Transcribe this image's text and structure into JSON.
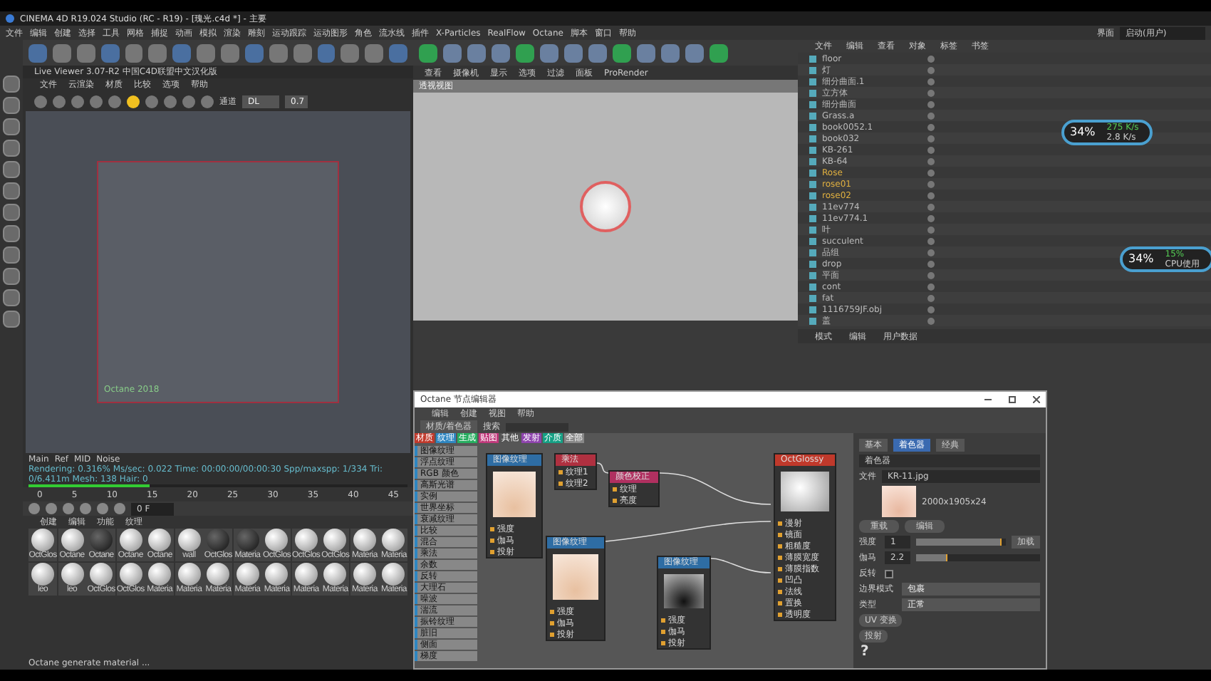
{
  "window": {
    "title": "CINEMA 4D R19.024 Studio (RC - R19) - [瑰光.c4d *] - 主要"
  },
  "menu": [
    "文件",
    "编辑",
    "创建",
    "选择",
    "工具",
    "网格",
    "捕捉",
    "动画",
    "模拟",
    "渲染",
    "雕刻",
    "运动跟踪",
    "运动图形",
    "角色",
    "流水线",
    "插件",
    "X-Particles",
    "RealFlow",
    "Octane",
    "脚本",
    "窗口",
    "帮助"
  ],
  "layout": {
    "label": "界面",
    "value": "启动(用户)"
  },
  "live_viewer": {
    "title": "Live Viewer 3.07-R2 中国C4D联盟中文汉化版",
    "menu": [
      "文件",
      "云渲染",
      "材质",
      "比较",
      "选项",
      "帮助"
    ],
    "mode_label": "通道",
    "mode_value": "DL",
    "value": "0.7",
    "overlay_text": "Octane 2018",
    "tabs": [
      "Main",
      "Ref",
      "MID",
      "Noise"
    ],
    "status": "Rendering: 0.316%  Ms/sec: 0.022  Time: 00:00:00/00:00:30  Spp/maxspp: 1/334  Tri: 0/6.411m  Mesh: 138  Hair: 0",
    "progress": {
      "level": 0.32
    },
    "ticks": [
      "0",
      "5",
      "10",
      "15",
      "20",
      "25",
      "30",
      "35",
      "40",
      "45"
    ],
    "frame": "0 F"
  },
  "materials": {
    "menu": [
      "创建",
      "编辑",
      "功能",
      "纹理"
    ],
    "items": [
      {
        "label": "OctGlos"
      },
      {
        "label": "Octane"
      },
      {
        "label": "Octane"
      },
      {
        "label": "Octane"
      },
      {
        "label": "Octane"
      },
      {
        "label": "wall"
      },
      {
        "label": "OctGlos"
      },
      {
        "label": "Materia"
      },
      {
        "label": "OctGlos"
      },
      {
        "label": "OctGlos"
      },
      {
        "label": "OctGlos"
      },
      {
        "label": "Materia"
      },
      {
        "label": "Materia"
      },
      {
        "label": "leo"
      },
      {
        "label": "leo"
      },
      {
        "label": "OctGlos"
      },
      {
        "label": "OctGlos"
      },
      {
        "label": "Materia"
      },
      {
        "label": "Materia"
      },
      {
        "label": "Materia"
      },
      {
        "label": "Materia"
      },
      {
        "label": "Materia"
      },
      {
        "label": "Materia"
      },
      {
        "label": "Materia"
      },
      {
        "label": "Materia"
      },
      {
        "label": "Materia"
      }
    ],
    "status": "Octane generate material ..."
  },
  "viewport": {
    "menu": [
      "查看",
      "摄像机",
      "显示",
      "选项",
      "过滤",
      "面板",
      "ProRender"
    ],
    "label": "透视视图"
  },
  "objects": {
    "tabs": [
      "文件",
      "编辑",
      "查看",
      "对象",
      "标签",
      "书签"
    ],
    "rows": [
      {
        "name": "floor",
        "highlight": false
      },
      {
        "name": "灯",
        "highlight": false
      },
      {
        "name": "细分曲面.1",
        "highlight": false
      },
      {
        "name": "立方体",
        "highlight": false
      },
      {
        "name": "细分曲面",
        "highlight": false
      },
      {
        "name": "Grass.a",
        "highlight": false
      },
      {
        "name": "book0052.1",
        "highlight": false
      },
      {
        "name": "book032",
        "highlight": false
      },
      {
        "name": "KB-261",
        "highlight": false
      },
      {
        "name": "KB-64",
        "highlight": false
      },
      {
        "name": "Rose",
        "highlight": true
      },
      {
        "name": "rose01",
        "highlight": true
      },
      {
        "name": "rose02",
        "highlight": true
      },
      {
        "name": "11ev774",
        "highlight": false
      },
      {
        "name": "11ev774.1",
        "highlight": false
      },
      {
        "name": "叶",
        "highlight": false
      },
      {
        "name": "succulent",
        "highlight": false
      },
      {
        "name": "品组",
        "highlight": false
      },
      {
        "name": "drop",
        "highlight": false
      },
      {
        "name": "平面",
        "highlight": false
      },
      {
        "name": "cont",
        "highlight": false
      },
      {
        "name": "fat",
        "highlight": false
      },
      {
        "name": "1116759JF.obj",
        "highlight": false
      },
      {
        "name": "盖",
        "highlight": false
      }
    ]
  },
  "monitor": [
    {
      "value": "34%",
      "line_1": "275 K/s",
      "line_2": "2.8 K/s"
    },
    {
      "value": "34%",
      "line_1": "15%",
      "line_2": "CPU使用"
    }
  ],
  "attributes": {
    "menu": [
      "模式",
      "编辑",
      "用户数据"
    ],
    "tabs": [
      {
        "label": "基本",
        "selected": false
      },
      {
        "label": "着色器",
        "selected": true
      },
      {
        "label": "经典",
        "selected": false
      }
    ],
    "section": "着色器",
    "file_label": "文件",
    "file": "KR-11.jpg",
    "image_info": "2000x1905x24",
    "buttons": [
      "重载",
      "编辑"
    ],
    "fields": [
      {
        "label": "强度",
        "value": "1",
        "level": 0.95,
        "button": "加载"
      },
      {
        "label": "伽马",
        "value": "2.2",
        "level": 0.25
      }
    ],
    "invert_label": "反转",
    "invert": false,
    "selects": [
      {
        "label": "边界模式",
        "value": "包裹"
      },
      {
        "label": "类型",
        "value": "正常"
      }
    ],
    "extra_buttons": [
      "UV 变换",
      "投射"
    ],
    "help": "?"
  },
  "node_editor": {
    "title": "Octane 节点编辑器",
    "menu": [
      "编辑",
      "创建",
      "视图",
      "帮助"
    ],
    "mode_button": "材质/着色器",
    "search": "搜索",
    "categories": [
      {
        "label": "材质",
        "color": "#c0392b"
      },
      {
        "label": "纹理",
        "color": "#2e86c1"
      },
      {
        "label": "生成",
        "color": "#27ae60"
      },
      {
        "label": "贴图",
        "color": "#c0397b"
      },
      {
        "label": "其他",
        "color": "#555555"
      },
      {
        "label": "发射",
        "color": "#8e44ad"
      },
      {
        "label": "介质",
        "color": "#16a085"
      },
      {
        "label": "全部",
        "color": "#888888"
      }
    ],
    "list": [
      "图像纹理",
      "浮点纹理",
      "RGB 颜色",
      "高斯光谱",
      "实例",
      "世界坐标",
      "衰减纹理",
      "比较",
      "混合",
      "乘法",
      "余数",
      "反转",
      "大理石",
      "噪波",
      "湍流",
      "振铃纹理",
      "脏旧",
      "侧面",
      "梯度"
    ],
    "nodes": [
      {
        "title": "图像纹理",
        "kind": "texture",
        "color": "#2e6da4",
        "ports": [
          "强度",
          "伽马",
          "投射"
        ]
      },
      {
        "title": "乘法",
        "kind": "op",
        "color": "#b03040",
        "ports": [
          "纹理1",
          "纹理2"
        ]
      },
      {
        "title": "颜色校正",
        "kind": "op",
        "color": "#b03060",
        "ports": [
          "纹理",
          "亮度"
        ]
      },
      {
        "title": "图像纹理",
        "kind": "texture",
        "color": "#2e6da4",
        "ports": [
          "强度",
          "伽马",
          "投射"
        ]
      },
      {
        "title": "图像纹理",
        "kind": "bw",
        "color": "#2e6da4",
        "ports": [
          "强度",
          "伽马",
          "投射"
        ]
      },
      {
        "title": "OctGlossy",
        "kind": "material",
        "color": "#c0392b",
        "ports": [
          "漫射",
          "镜面",
          "粗糙度",
          "薄膜宽度",
          "薄膜指数",
          "凹凸",
          "法线",
          "置换",
          "透明度"
        ]
      }
    ]
  }
}
